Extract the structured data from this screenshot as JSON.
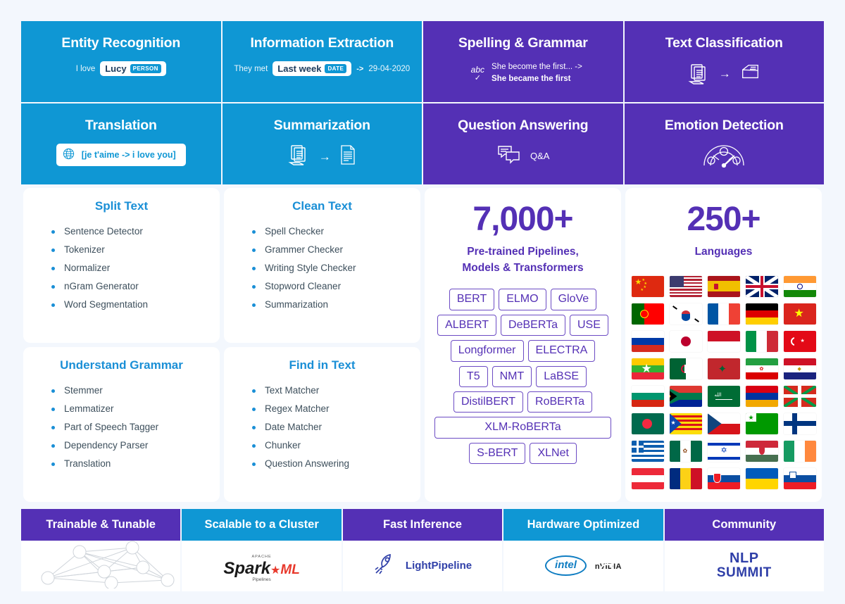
{
  "tasks": [
    {
      "title": "Entity Recognition",
      "theme": "blue",
      "prefix": "I love",
      "chip_text": "Lucy",
      "chip_tag": "PERSON"
    },
    {
      "title": "Information Extraction",
      "theme": "blue",
      "prefix": "They met",
      "chip_text": "Last week",
      "chip_tag": "DATE",
      "arrow": "->",
      "result": "29-04-2020"
    },
    {
      "title": "Spelling & Grammar",
      "theme": "purple",
      "icon": "abc-check-icon",
      "line1": "She become the first... ->",
      "line2": "She became the first"
    },
    {
      "title": "Text Classification",
      "theme": "purple",
      "icon_left": "documents-icon",
      "arrow": "→",
      "icon_right": "file-tray-icon"
    },
    {
      "title": "Translation",
      "theme": "blue",
      "icon": "globe-icon",
      "chip_text": "[je t'aime -> i love you]"
    },
    {
      "title": "Summarization",
      "theme": "blue",
      "icon_left": "documents-icon",
      "arrow": "→",
      "icon_right": "summary-document-icon"
    },
    {
      "title": "Question Answering",
      "theme": "purple",
      "icon": "chat-bubbles-icon",
      "label": "Q&A"
    },
    {
      "title": "Emotion Detection",
      "theme": "purple",
      "icon": "emotion-gauge-icon"
    }
  ],
  "panels": [
    {
      "title": "Split Text",
      "items": [
        "Sentence Detector",
        "Tokenizer",
        "Normalizer",
        "nGram Generator",
        "Word Segmentation"
      ]
    },
    {
      "title": "Clean Text",
      "items": [
        "Spell Checker",
        "Grammer Checker",
        "Writing Style Checker",
        "Stopword Cleaner",
        "Summarization"
      ]
    },
    {
      "title": "Understand Grammar",
      "items": [
        "Stemmer",
        "Lemmatizer",
        "Part of Speech Tagger",
        "Dependency Parser",
        "Translation"
      ]
    },
    {
      "title": "Find in Text",
      "items": [
        "Text Matcher",
        "Regex Matcher",
        "Date Matcher",
        "Chunker",
        "Question Answering"
      ]
    }
  ],
  "models_panel": {
    "count": "7,000+",
    "subtitle_line1": "Pre-trained Pipelines,",
    "subtitle_line2": "Models & Transformers",
    "chips": [
      "BERT",
      "ELMO",
      "GloVe",
      "ALBERT",
      "DeBERTa",
      "USE",
      "Longformer",
      "ELECTRA",
      "T5",
      "NMT",
      "LaBSE",
      "DistilBERT",
      "RoBERTa",
      "XLM-RoBERTa",
      "S-BERT",
      "XLNet"
    ]
  },
  "languages_panel": {
    "count": "250+",
    "label": "Languages",
    "flags": [
      "China",
      "United States",
      "Spain",
      "United Kingdom",
      "India",
      "Portugal",
      "South Korea",
      "France",
      "Germany",
      "Vietnam",
      "Russia",
      "Japan",
      "Indonesia",
      "Italy",
      "Turkey",
      "Myanmar",
      "Algeria",
      "Morocco",
      "Iran",
      "Egypt",
      "Bulgaria",
      "South Africa",
      "Saudi Arabia",
      "Armenia",
      "Basque Country",
      "Bangladesh",
      "Catalonia",
      "Czech Republic",
      "Esperanto",
      "Finland",
      "Greece",
      "Mexico",
      "Israel",
      "Hungary",
      "Ireland",
      "Austria",
      "Romania",
      "Slovakia",
      "Ukraine",
      "Slovenia"
    ]
  },
  "bottom": [
    {
      "title": "Trainable & Tunable",
      "theme": "purple",
      "logo": "neural-network-graphic"
    },
    {
      "title": "Scalable to a Cluster",
      "theme": "blue",
      "logo": "apache-spark-ml-logo",
      "apache": "APACHE",
      "spark": "Spark",
      "ml": "ML",
      "pipelines": "Pipelines"
    },
    {
      "title": "Fast Inference",
      "theme": "purple",
      "logo": "rocket-icon",
      "label": "LightPipeline"
    },
    {
      "title": "Hardware Optimized",
      "theme": "blue",
      "logo_1": "intel-logo",
      "intel": "intel",
      "logo_2": "nvidia-logo",
      "nvidia": "nVIDIA"
    },
    {
      "title": "Community",
      "theme": "purple",
      "logo": "nlp-summit-logo",
      "nlp": "NLP",
      "summit": "SUMMIT"
    }
  ],
  "colors": {
    "blue": "#0f97d4",
    "purple": "#5430b5",
    "background": "#f3f7fd",
    "panel_title": "#1a8fd6",
    "list_text": "#3d4f5c"
  }
}
